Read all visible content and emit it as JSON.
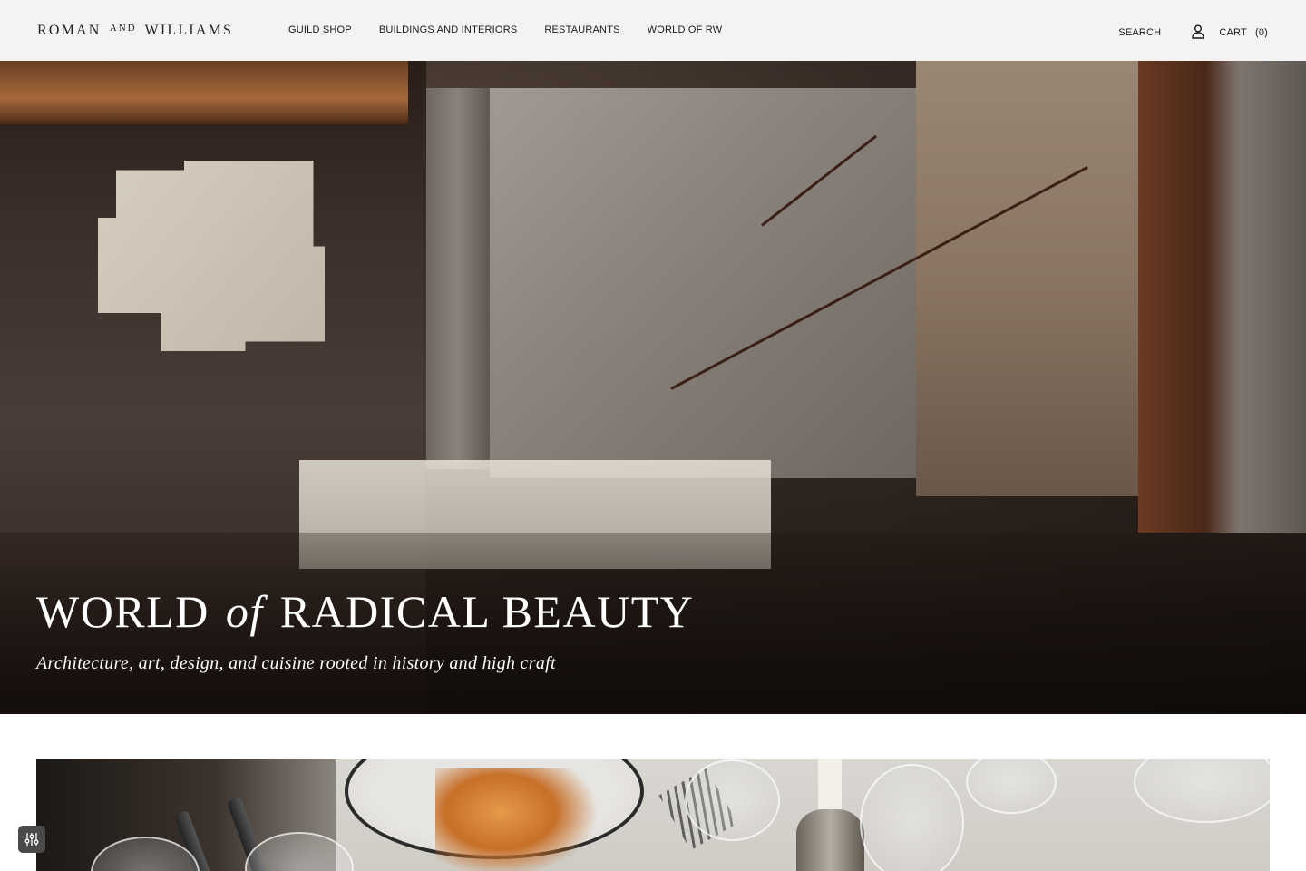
{
  "header": {
    "logo": {
      "part1": "ROMAN",
      "part2": "AND",
      "part3": "WILLIAMS"
    },
    "nav": [
      {
        "label": "GUILD SHOP"
      },
      {
        "label": "BUILDINGS AND INTERIORS"
      },
      {
        "label": "RESTAURANTS"
      },
      {
        "label": "WORLD OF RW"
      }
    ],
    "utility": {
      "search_label": "SEARCH",
      "account_icon": "user-icon",
      "cart_label": "CART",
      "cart_count": "(0)"
    }
  },
  "hero": {
    "title_part1": "WORLD",
    "title_of": "of",
    "title_part2": "RADICAL BEAUTY",
    "subtitle": "Architecture, art, design, and cuisine rooted in history and high craft"
  },
  "floating_control": {
    "icon": "sliders-icon"
  },
  "colors": {
    "header_bg": "#f4f3f1",
    "text_dark": "#1a1a1a",
    "hero_text": "#ffffff",
    "control_bg": "#4a4a4a"
  }
}
